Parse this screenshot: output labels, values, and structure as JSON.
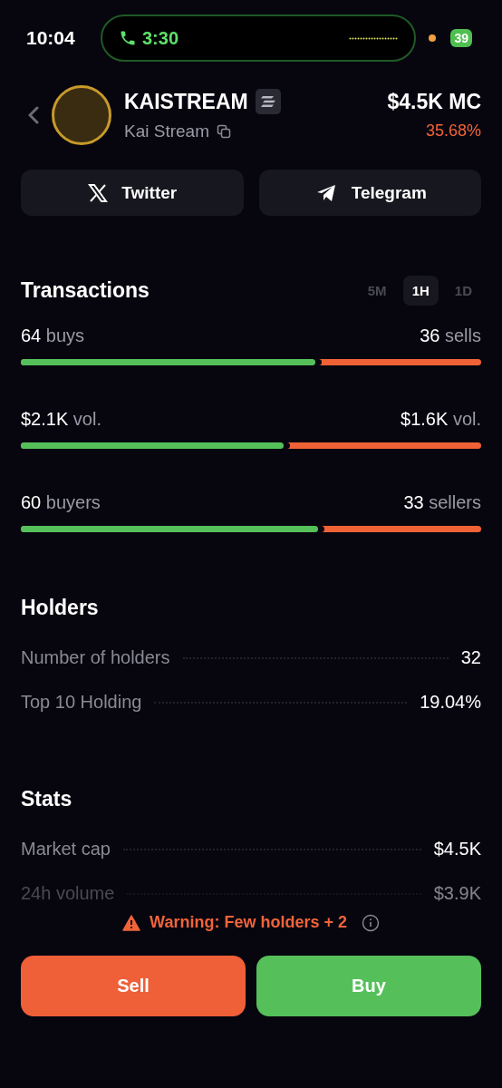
{
  "status_bar": {
    "time": "10:04",
    "call_time": "3:30",
    "battery": "39"
  },
  "token": {
    "symbol": "KAISTREAM",
    "name": "Kai Stream",
    "market_cap": "$4.5K MC",
    "change": "35.68%"
  },
  "social": [
    {
      "kind": "x",
      "label": "Twitter"
    },
    {
      "kind": "telegram",
      "label": "Telegram"
    }
  ],
  "transactions": {
    "title": "Transactions",
    "periods": [
      {
        "label": "5M",
        "selected": false
      },
      {
        "label": "1H",
        "selected": true
      },
      {
        "label": "1D",
        "selected": false
      }
    ],
    "rows": [
      {
        "buy_value": "64",
        "buy_label": "buys",
        "sell_value": "36",
        "sell_label": "sells",
        "level": 0.64
      },
      {
        "buy_value": "$2.1K",
        "buy_label": "vol.",
        "sell_value": "$1.6K",
        "sell_label": "vol.",
        "level": 0.57
      },
      {
        "buy_value": "60",
        "buy_label": "buyers",
        "sell_value": "33",
        "sell_label": "sellers",
        "level": 0.645
      }
    ]
  },
  "holders": {
    "title": "Holders",
    "rows": [
      {
        "label": "Number of holders",
        "value": "32"
      },
      {
        "label": "Top 10 Holding",
        "value": "19.04%"
      }
    ]
  },
  "stats": {
    "title": "Stats",
    "rows": [
      {
        "label": "Market cap",
        "value": "$4.5K",
        "faded": false
      },
      {
        "label": "24h volume",
        "value": "$3.9K",
        "faded": true
      }
    ]
  },
  "warning": "Warning: Few holders + 2",
  "actions": [
    {
      "kind": "sell",
      "label": "Sell"
    },
    {
      "kind": "buy",
      "label": "Buy"
    }
  ]
}
